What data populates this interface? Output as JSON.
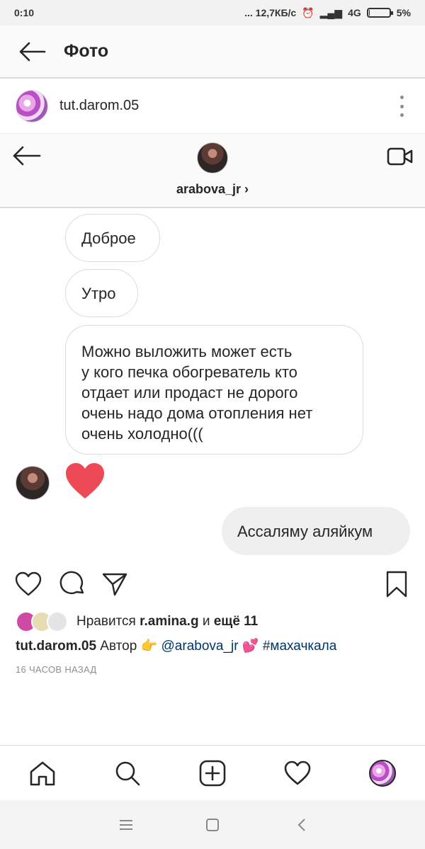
{
  "status_bar": {
    "time": "0:10",
    "network": "... 12,7КБ/с",
    "signal": "4G",
    "battery": "5%",
    "battery_level": 0.05
  },
  "header": {
    "title": "Фото"
  },
  "post": {
    "username": "tut.darom.05"
  },
  "chat": {
    "username": "arabova_jr",
    "chevron": "›",
    "messages": [
      {
        "text": "Доброе",
        "from": "other"
      },
      {
        "text": "Утро",
        "from": "other"
      },
      {
        "lines": [
          "Можно выложить может есть",
          "у кого печка обогреватель кто",
          "отдает или продаст не дорого",
          "очень надо дома отопления нет",
          "очень холодно((("
        ],
        "from": "other"
      },
      {
        "text": "Ассаляму аляйкум",
        "from": "me"
      }
    ]
  },
  "likes": {
    "prefix": "Нравится ",
    "user": "r.amina.g",
    "middle": " и ",
    "more": "ещё 11"
  },
  "caption": {
    "username": "tut.darom.05",
    "text1": " Автор ",
    "emoji1": "👉",
    "mention": "@arabova_jr",
    "emoji2": "💕",
    "hashtag": "#махачкала"
  },
  "timestamp": "16 ЧАСОВ НАЗАД",
  "colors": {
    "heart": "#ed4956",
    "link": "#003569",
    "muted": "#8e8e8e"
  }
}
